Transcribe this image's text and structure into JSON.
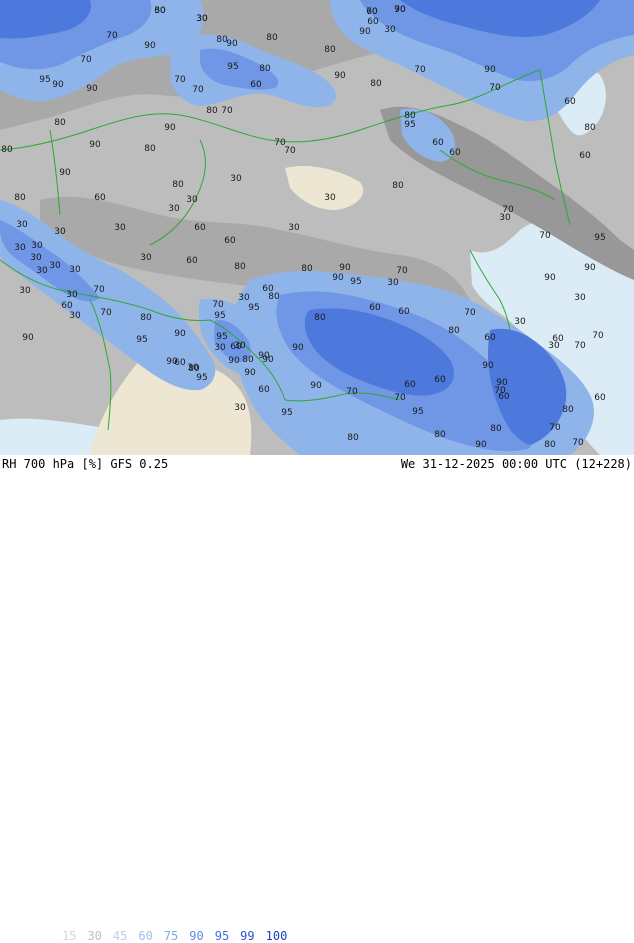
{
  "footer": {
    "title": "RH 700 hPa [%] GFS 0.25",
    "valid_time": "We 31-12-2025 00:00 UTC (12+228)"
  },
  "legend": [
    {
      "label": "15",
      "color": "#d4d4d4"
    },
    {
      "label": "30",
      "color": "#c0c0c0"
    },
    {
      "label": "45",
      "color": "#bcd0e4"
    },
    {
      "label": "60",
      "color": "#9fc2ec"
    },
    {
      "label": "75",
      "color": "#7fa9e8"
    },
    {
      "label": "90",
      "color": "#5e8ee6"
    },
    {
      "label": "95",
      "color": "#3f6fe0"
    },
    {
      "label": "99",
      "color": "#2a55d0"
    },
    {
      "label": "100",
      "color": "#1a40c0"
    }
  ],
  "map": {
    "colors": {
      "dry_land": "#ece6d2",
      "sea": "#dcecf6",
      "gray_low": "#bdbdbd",
      "gray_mid": "#a9a9a9",
      "gray_dark": "#989898",
      "blue_light": "#8fb4ea",
      "blue_mid": "#6f97e6",
      "blue_dark": "#4d78dc",
      "border": "#2fa830"
    },
    "contour_labels": [
      {
        "text": "60"
      },
      {
        "text": "30"
      },
      {
        "text": "60"
      },
      {
        "text": "90"
      },
      {
        "text": "60"
      },
      {
        "text": "70"
      },
      {
        "text": "90"
      },
      {
        "text": "80"
      },
      {
        "text": "70"
      },
      {
        "text": "90"
      },
      {
        "text": "80"
      },
      {
        "text": "30"
      },
      {
        "text": "90"
      },
      {
        "text": "80"
      },
      {
        "text": "95"
      },
      {
        "text": "90"
      },
      {
        "text": "90"
      },
      {
        "text": "70"
      },
      {
        "text": "95"
      },
      {
        "text": "80"
      },
      {
        "text": "70"
      },
      {
        "text": "80"
      },
      {
        "text": "70"
      },
      {
        "text": "60"
      },
      {
        "text": "90"
      },
      {
        "text": "80"
      },
      {
        "text": "70"
      },
      {
        "text": "90"
      },
      {
        "text": "70"
      },
      {
        "text": "60"
      },
      {
        "text": "80"
      },
      {
        "text": "80"
      },
      {
        "text": "90"
      },
      {
        "text": "80"
      },
      {
        "text": "95"
      },
      {
        "text": "60"
      },
      {
        "text": "60"
      },
      {
        "text": "80"
      },
      {
        "text": "90"
      },
      {
        "text": "80"
      },
      {
        "text": "70"
      },
      {
        "text": "70"
      },
      {
        "text": "90"
      },
      {
        "text": "80"
      },
      {
        "text": "30"
      },
      {
        "text": "80"
      },
      {
        "text": "30"
      },
      {
        "text": "30"
      },
      {
        "text": "60"
      },
      {
        "text": "30"
      },
      {
        "text": "30"
      },
      {
        "text": "30"
      },
      {
        "text": "30"
      },
      {
        "text": "30"
      },
      {
        "text": "30"
      },
      {
        "text": "30"
      },
      {
        "text": "30"
      },
      {
        "text": "30"
      },
      {
        "text": "30"
      },
      {
        "text": "60"
      },
      {
        "text": "80"
      },
      {
        "text": "80"
      },
      {
        "text": "90"
      },
      {
        "text": "90"
      },
      {
        "text": "95"
      },
      {
        "text": "70"
      },
      {
        "text": "30"
      },
      {
        "text": "70"
      },
      {
        "text": "70"
      },
      {
        "text": "30"
      },
      {
        "text": "60"
      },
      {
        "text": "30"
      },
      {
        "text": "30"
      },
      {
        "text": "70"
      },
      {
        "text": "60"
      },
      {
        "text": "30"
      },
      {
        "text": "70"
      },
      {
        "text": "80"
      },
      {
        "text": "90"
      },
      {
        "text": "70"
      },
      {
        "text": "30"
      },
      {
        "text": "60"
      },
      {
        "text": "80"
      },
      {
        "text": "90"
      },
      {
        "text": "95"
      },
      {
        "text": "95"
      },
      {
        "text": "60"
      },
      {
        "text": "60"
      },
      {
        "text": "70"
      },
      {
        "text": "30"
      },
      {
        "text": "30"
      },
      {
        "text": "70"
      },
      {
        "text": "60"
      },
      {
        "text": "70"
      },
      {
        "text": "60"
      },
      {
        "text": "80"
      },
      {
        "text": "95"
      },
      {
        "text": "90"
      },
      {
        "text": "90"
      },
      {
        "text": "80"
      },
      {
        "text": "95"
      },
      {
        "text": "60"
      },
      {
        "text": "80"
      },
      {
        "text": "90"
      },
      {
        "text": "90"
      },
      {
        "text": "30"
      },
      {
        "text": "30"
      },
      {
        "text": "90"
      },
      {
        "text": "30"
      },
      {
        "text": "60"
      },
      {
        "text": "95"
      },
      {
        "text": "90"
      },
      {
        "text": "90"
      },
      {
        "text": "90"
      },
      {
        "text": "70"
      },
      {
        "text": "60"
      },
      {
        "text": "60"
      },
      {
        "text": "60"
      },
      {
        "text": "90"
      },
      {
        "text": "70"
      },
      {
        "text": "70"
      },
      {
        "text": "95"
      },
      {
        "text": "80"
      },
      {
        "text": "70"
      },
      {
        "text": "80"
      },
      {
        "text": "95"
      },
      {
        "text": "80"
      },
      {
        "text": "80"
      },
      {
        "text": "90"
      },
      {
        "text": "80"
      },
      {
        "text": "70"
      },
      {
        "text": "60"
      },
      {
        "text": "95"
      },
      {
        "text": "90"
      },
      {
        "text": "80"
      },
      {
        "text": "60"
      },
      {
        "text": "30"
      },
      {
        "text": "80"
      },
      {
        "text": "30"
      },
      {
        "text": "30"
      },
      {
        "text": "60"
      },
      {
        "text": "90"
      },
      {
        "text": "60"
      },
      {
        "text": "30"
      },
      {
        "text": "30"
      },
      {
        "text": "30"
      },
      {
        "text": "70"
      },
      {
        "text": "70"
      }
    ]
  }
}
